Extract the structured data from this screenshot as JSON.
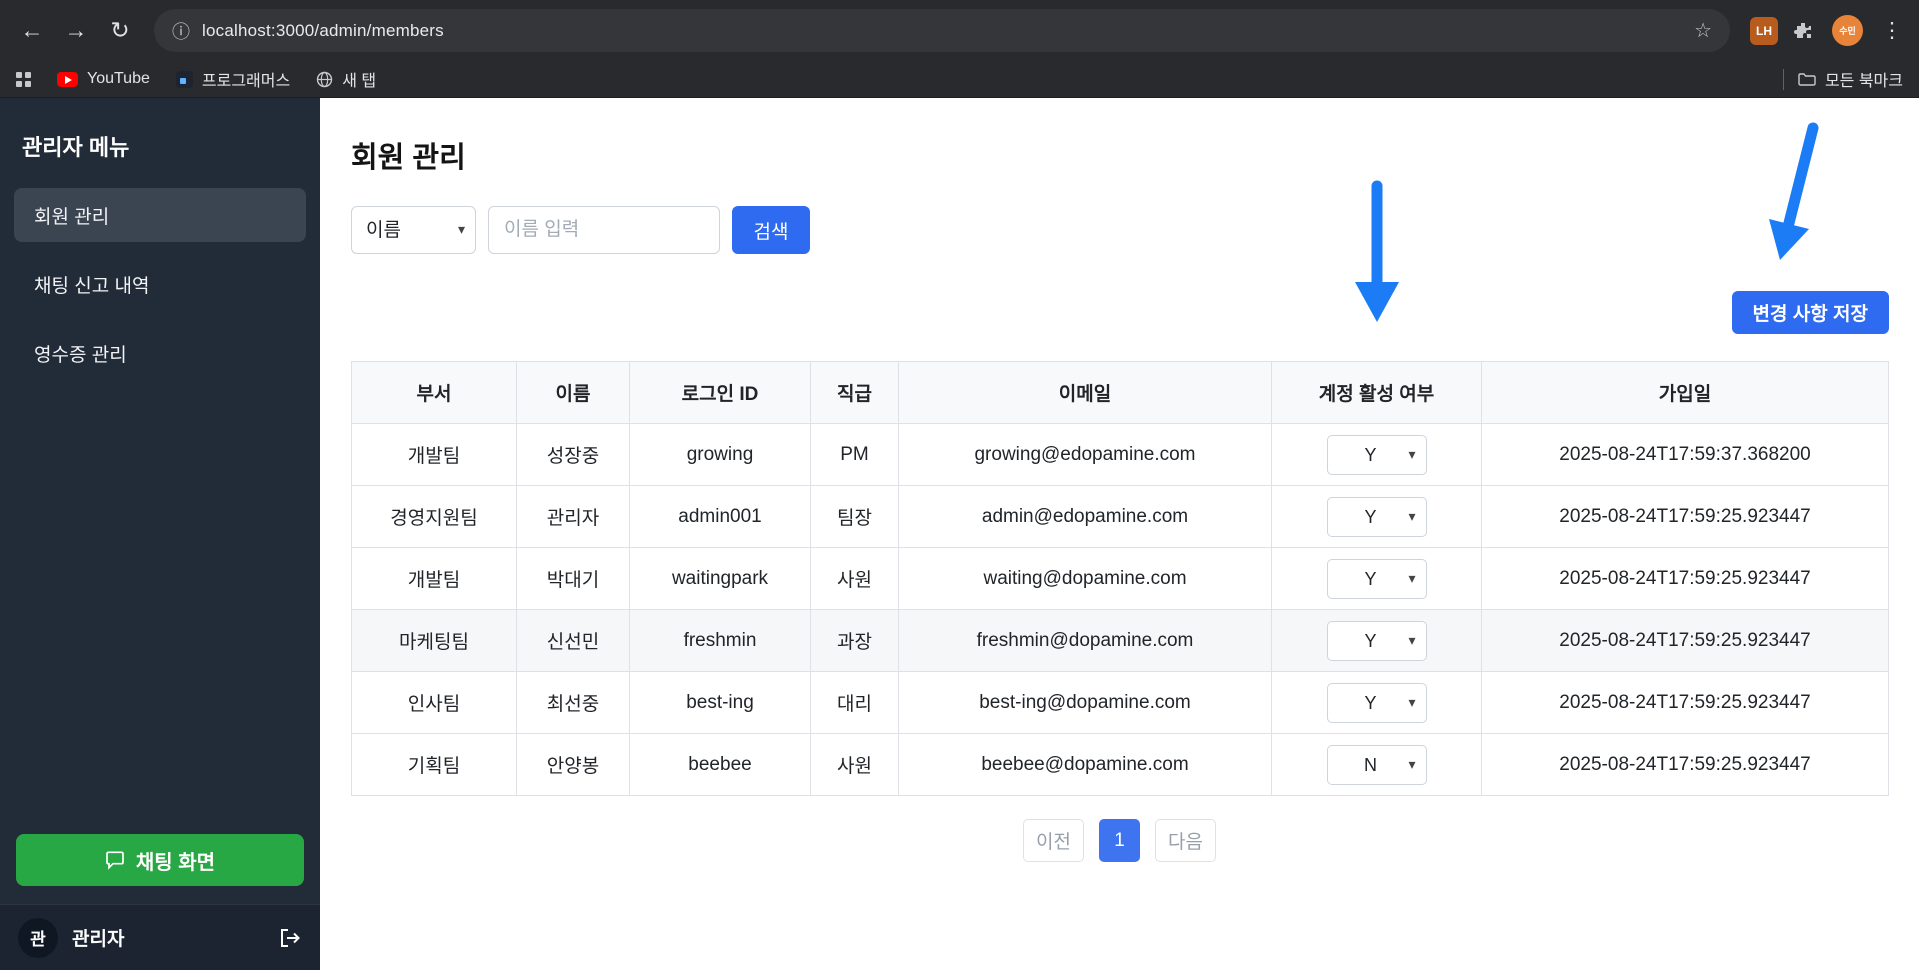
{
  "browser": {
    "url": "localhost:3000/admin/members",
    "profile_label": "수민",
    "extension_badge": "LH",
    "bookmarks": [
      {
        "label": "YouTube"
      },
      {
        "label": "프로그래머스"
      },
      {
        "label": "새 탭"
      }
    ],
    "all_bookmarks_label": "모든 북마크"
  },
  "sidebar": {
    "title": "관리자 메뉴",
    "items": [
      {
        "label": "회원 관리"
      },
      {
        "label": "채팅 신고 내역"
      },
      {
        "label": "영수증 관리"
      }
    ],
    "chat_button_label": "채팅 화면",
    "user": {
      "avatar_initial": "관",
      "name": "관리자"
    }
  },
  "main": {
    "page_title": "회원 관리",
    "search": {
      "filter_selected": "이름",
      "input_placeholder": "이름 입력",
      "search_button_label": "검색"
    },
    "save_button_label": "변경 사항 저장",
    "table": {
      "headers": [
        "부서",
        "이름",
        "로그인 ID",
        "직급",
        "이메일",
        "계정 활성 여부",
        "가입일"
      ],
      "rows": [
        {
          "dept": "개발팀",
          "name": "성장중",
          "login_id": "growing",
          "rank": "PM",
          "email": "growing@edopamine.com",
          "active": "Y",
          "joined": "2025-08-24T17:59:37.368200"
        },
        {
          "dept": "경영지원팀",
          "name": "관리자",
          "login_id": "admin001",
          "rank": "팀장",
          "email": "admin@edopamine.com",
          "active": "Y",
          "joined": "2025-08-24T17:59:25.923447"
        },
        {
          "dept": "개발팀",
          "name": "박대기",
          "login_id": "waitingpark",
          "rank": "사원",
          "email": "waiting@dopamine.com",
          "active": "Y",
          "joined": "2025-08-24T17:59:25.923447"
        },
        {
          "dept": "마케팅팀",
          "name": "신선민",
          "login_id": "freshmin",
          "rank": "과장",
          "email": "freshmin@dopamine.com",
          "active": "Y",
          "joined": "2025-08-24T17:59:25.923447"
        },
        {
          "dept": "인사팀",
          "name": "최선중",
          "login_id": "best-ing",
          "rank": "대리",
          "email": "best-ing@dopamine.com",
          "active": "Y",
          "joined": "2025-08-24T17:59:25.923447"
        },
        {
          "dept": "기획팀",
          "name": "안양봉",
          "login_id": "beebee",
          "rank": "사원",
          "email": "beebee@dopamine.com",
          "active": "N",
          "joined": "2025-08-24T17:59:25.923447"
        }
      ]
    },
    "pagination": {
      "prev_label": "이전",
      "current_page": "1",
      "next_label": "다음"
    }
  },
  "colors": {
    "accent_blue": "#2f6bf0",
    "pagination_active_blue": "#3e74f0",
    "annotation_arrow_blue": "#1b7cf5",
    "sidebar_bg": "#222b38",
    "chat_button_green": "#28a745",
    "table_header_bg": "#f8f9fa"
  }
}
